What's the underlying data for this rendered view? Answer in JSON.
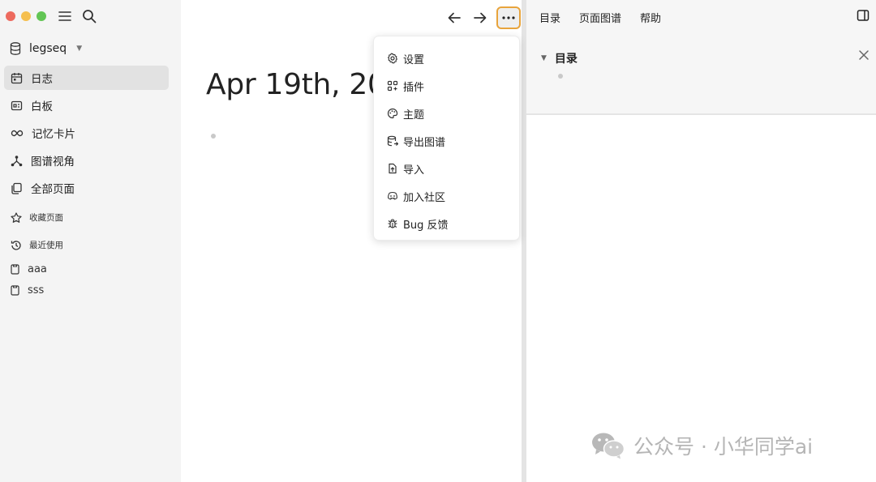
{
  "sidebar": {
    "graph_name": "legseq",
    "nav": [
      {
        "label": "日志",
        "icon": "calendar-icon",
        "active": true
      },
      {
        "label": "白板",
        "icon": "whiteboard-icon"
      },
      {
        "label": "记忆卡片",
        "icon": "infinity-icon"
      },
      {
        "label": "图谱视角",
        "icon": "graph-icon"
      },
      {
        "label": "全部页面",
        "icon": "pages-icon"
      }
    ],
    "favorites_label": "收藏页面",
    "recent_label": "最近使用",
    "recent_pages": [
      "aaa",
      "sss"
    ]
  },
  "main": {
    "journal_title": "Apr 19th, 2024"
  },
  "menu": {
    "items": [
      {
        "label": "设置",
        "icon": "gear-icon"
      },
      {
        "label": "插件",
        "icon": "plugin-icon"
      },
      {
        "label": "主题",
        "icon": "palette-icon"
      },
      {
        "label": "导出图谱",
        "icon": "export-icon"
      },
      {
        "label": "导入",
        "icon": "import-icon"
      },
      {
        "label": "加入社区",
        "icon": "discord-icon"
      },
      {
        "label": "Bug 反馈",
        "icon": "bug-icon"
      }
    ]
  },
  "right_panel": {
    "tabs": [
      "目录",
      "页面图谱",
      "帮助"
    ],
    "toc_title": "目录"
  },
  "watermark": {
    "text": "公众号 · 小华同学ai"
  },
  "colors": {
    "accent": "#e8a43c",
    "sidebar_bg": "#f4f4f4",
    "active_bg": "#e2e2e2"
  }
}
